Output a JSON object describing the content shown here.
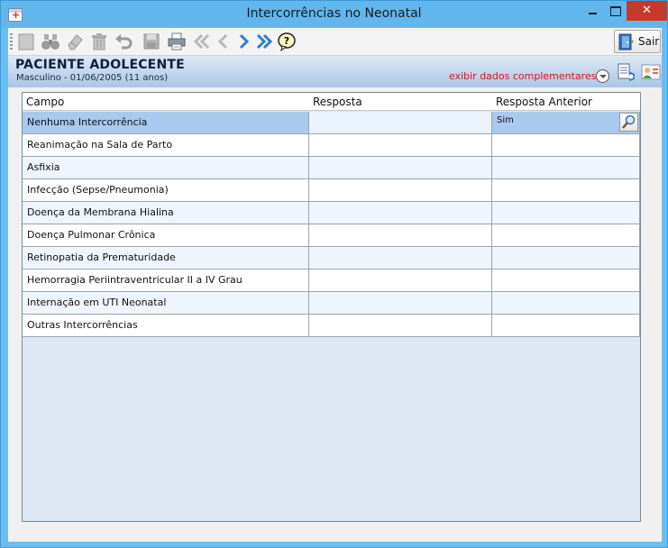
{
  "window": {
    "title": "Intercorrências no Neonatal",
    "close_glyph": "✕"
  },
  "toolbar": {
    "exit_label": "Sair",
    "icons": [
      "new-icon",
      "binoculars-icon",
      "eraser-icon",
      "trash-icon",
      "undo-icon",
      "save-icon",
      "print-icon",
      "first-icon",
      "previous-icon",
      "next-icon",
      "last-icon",
      "help-icon"
    ]
  },
  "patient": {
    "name": "PACIENTE ADOLECENTE",
    "info": "Masculino - 01/06/2005 (11 anos)",
    "more_link": "exibir dados complementares..."
  },
  "grid": {
    "columns": [
      "Campo",
      "Resposta",
      "Resposta Anterior"
    ],
    "rows": [
      {
        "campo": "Nenhuma Intercorrência",
        "resposta": "",
        "anterior": "Sim"
      },
      {
        "campo": "Reanimação na Sala de Parto",
        "resposta": "",
        "anterior": ""
      },
      {
        "campo": "Asfixia",
        "resposta": "",
        "anterior": ""
      },
      {
        "campo": "Infecção (Sepse/Pneumonia)",
        "resposta": "",
        "anterior": ""
      },
      {
        "campo": "Doença da Membrana Hialina",
        "resposta": "",
        "anterior": ""
      },
      {
        "campo": "Doença Pulmonar Crônica",
        "resposta": "",
        "anterior": ""
      },
      {
        "campo": "Retinopatia da Prematuridade",
        "resposta": "",
        "anterior": ""
      },
      {
        "campo": "Hemorragia Periintraventricular II a IV Grau",
        "resposta": "",
        "anterior": ""
      },
      {
        "campo": "Internação em UTI Neonatal",
        "resposta": "",
        "anterior": ""
      },
      {
        "campo": "Outras Intercorrências",
        "resposta": "",
        "anterior": ""
      }
    ]
  },
  "colors": {
    "title_bar": "#62b6ee",
    "close_button": "#c7392c",
    "link_red": "#e0101a",
    "selected_row": "#a9c9ee"
  }
}
